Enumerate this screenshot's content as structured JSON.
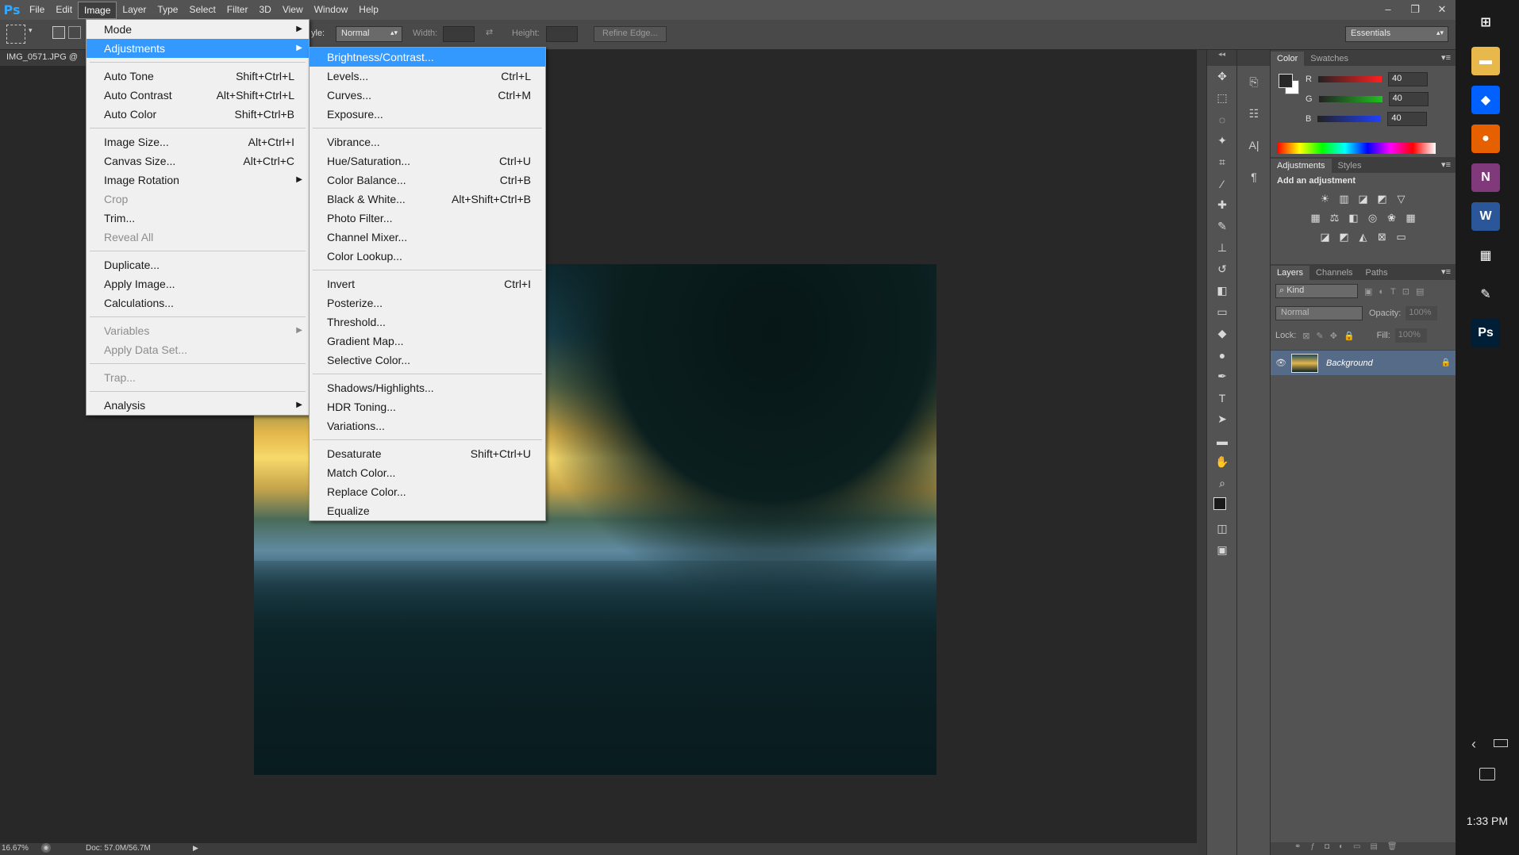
{
  "menubar": {
    "logo": "Ps",
    "items": [
      "File",
      "Edit",
      "Image",
      "Layer",
      "Type",
      "Select",
      "Filter",
      "3D",
      "View",
      "Window",
      "Help"
    ],
    "active_index": 2,
    "window_controls": [
      "–",
      "❐",
      "✕"
    ]
  },
  "options": {
    "style_label": "yle:",
    "style_value": "Normal",
    "width_label": "Width:",
    "height_label": "Height:",
    "refine_edge": "Refine Edge...",
    "workspace": "Essentials"
  },
  "document": {
    "tab_title": "IMG_0571.JPG @",
    "zoom": "16.67%",
    "doc_info": "Doc: 57.0M/56.7M"
  },
  "image_menu": {
    "groups": [
      [
        {
          "label": "Mode",
          "shortcut": "",
          "submenu": true,
          "disabled": false
        },
        {
          "label": "Adjustments",
          "shortcut": "",
          "submenu": true,
          "disabled": false,
          "highlight": true
        }
      ],
      [
        {
          "label": "Auto Tone",
          "shortcut": "Shift+Ctrl+L"
        },
        {
          "label": "Auto Contrast",
          "shortcut": "Alt+Shift+Ctrl+L"
        },
        {
          "label": "Auto Color",
          "shortcut": "Shift+Ctrl+B"
        }
      ],
      [
        {
          "label": "Image Size...",
          "shortcut": "Alt+Ctrl+I"
        },
        {
          "label": "Canvas Size...",
          "shortcut": "Alt+Ctrl+C"
        },
        {
          "label": "Image Rotation",
          "shortcut": "",
          "submenu": true
        },
        {
          "label": "Crop",
          "shortcut": "",
          "disabled": true
        },
        {
          "label": "Trim...",
          "shortcut": ""
        },
        {
          "label": "Reveal All",
          "shortcut": "",
          "disabled": true
        }
      ],
      [
        {
          "label": "Duplicate...",
          "shortcut": ""
        },
        {
          "label": "Apply Image...",
          "shortcut": ""
        },
        {
          "label": "Calculations...",
          "shortcut": ""
        }
      ],
      [
        {
          "label": "Variables",
          "shortcut": "",
          "submenu": true,
          "disabled": true
        },
        {
          "label": "Apply Data Set...",
          "shortcut": "",
          "disabled": true
        }
      ],
      [
        {
          "label": "Trap...",
          "shortcut": "",
          "disabled": true
        }
      ],
      [
        {
          "label": "Analysis",
          "shortcut": "",
          "submenu": true
        }
      ]
    ]
  },
  "adjust_menu": {
    "groups": [
      [
        {
          "label": "Brightness/Contrast...",
          "shortcut": "",
          "highlight": true
        },
        {
          "label": "Levels...",
          "shortcut": "Ctrl+L"
        },
        {
          "label": "Curves...",
          "shortcut": "Ctrl+M"
        },
        {
          "label": "Exposure...",
          "shortcut": ""
        }
      ],
      [
        {
          "label": "Vibrance...",
          "shortcut": ""
        },
        {
          "label": "Hue/Saturation...",
          "shortcut": "Ctrl+U"
        },
        {
          "label": "Color Balance...",
          "shortcut": "Ctrl+B"
        },
        {
          "label": "Black & White...",
          "shortcut": "Alt+Shift+Ctrl+B"
        },
        {
          "label": "Photo Filter...",
          "shortcut": ""
        },
        {
          "label": "Channel Mixer...",
          "shortcut": ""
        },
        {
          "label": "Color Lookup...",
          "shortcut": ""
        }
      ],
      [
        {
          "label": "Invert",
          "shortcut": "Ctrl+I"
        },
        {
          "label": "Posterize...",
          "shortcut": ""
        },
        {
          "label": "Threshold...",
          "shortcut": ""
        },
        {
          "label": "Gradient Map...",
          "shortcut": ""
        },
        {
          "label": "Selective Color...",
          "shortcut": ""
        }
      ],
      [
        {
          "label": "Shadows/Highlights...",
          "shortcut": ""
        },
        {
          "label": "HDR Toning...",
          "shortcut": ""
        },
        {
          "label": "Variations...",
          "shortcut": ""
        }
      ],
      [
        {
          "label": "Desaturate",
          "shortcut": "Shift+Ctrl+U"
        },
        {
          "label": "Match Color...",
          "shortcut": ""
        },
        {
          "label": "Replace Color...",
          "shortcut": ""
        },
        {
          "label": "Equalize",
          "shortcut": ""
        }
      ]
    ]
  },
  "color_panel": {
    "tabs": [
      "Color",
      "Swatches"
    ],
    "channels": [
      {
        "name": "R",
        "value": "40",
        "color": "#ff2020"
      },
      {
        "name": "G",
        "value": "40",
        "color": "#20c020"
      },
      {
        "name": "B",
        "value": "40",
        "color": "#2040ff"
      }
    ]
  },
  "adjustments_panel": {
    "tabs": [
      "Adjustments",
      "Styles"
    ],
    "heading": "Add an adjustment"
  },
  "layers_panel": {
    "tabs": [
      "Layers",
      "Channels",
      "Paths"
    ],
    "kind_label": "Kind",
    "blend_mode": "Normal",
    "opacity_label": "Opacity:",
    "opacity_value": "100%",
    "lock_label": "Lock:",
    "fill_label": "Fill:",
    "fill_value": "100%",
    "layer_name": "Background"
  },
  "taskbar": {
    "time": "1:33 PM",
    "apps": [
      {
        "name": "windows",
        "label": "⊞",
        "color": "#1a1a1a"
      },
      {
        "name": "folder",
        "label": "▬",
        "color": "#e9b84a"
      },
      {
        "name": "dropbox",
        "label": "◆",
        "color": "#0061fe"
      },
      {
        "name": "firefox",
        "label": "●",
        "color": "#e66000"
      },
      {
        "name": "onenote",
        "label": "N",
        "color": "#80397b"
      },
      {
        "name": "word",
        "label": "W",
        "color": "#2b579a"
      },
      {
        "name": "calendar",
        "label": "▦",
        "color": "#1a1a1a"
      },
      {
        "name": "pencil",
        "label": "✎",
        "color": "#1a1a1a"
      },
      {
        "name": "photoshop",
        "label": "Ps",
        "color": "#001e36"
      }
    ]
  }
}
